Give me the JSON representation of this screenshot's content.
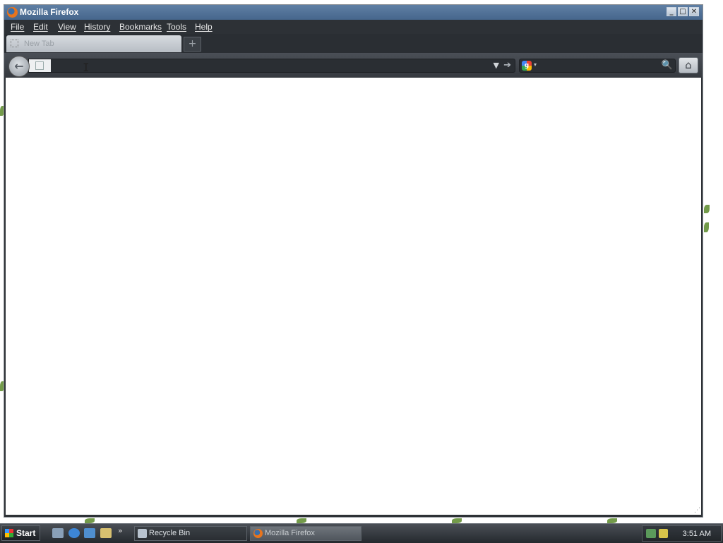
{
  "window": {
    "title": "Mozilla Firefox",
    "minimize_glyph": "_",
    "maximize_glyph": "□",
    "close_glyph": "✕"
  },
  "menubar": {
    "items": [
      "File",
      "Edit",
      "View",
      "History",
      "Bookmarks",
      "Tools",
      "Help"
    ]
  },
  "tabs": {
    "items": [
      {
        "label": "New Tab",
        "icon": "blank-page-icon"
      }
    ],
    "new_tab_glyph": "+"
  },
  "navbar": {
    "back_glyph": "←",
    "url_value": "",
    "dropdown_glyph": "▼",
    "go_glyph": "➔",
    "search_engine_letter": "g",
    "search_engine_arrow": "▾",
    "search_value": "",
    "search_glyph": "🔍",
    "home_glyph": "⌂"
  },
  "content": {
    "resize_glyph": "⋰"
  },
  "taskbar": {
    "start_label": "Start",
    "quick_launch_more": "»",
    "items": [
      {
        "label": "Recycle Bin",
        "icon": "recycle-bin-icon",
        "active": false
      },
      {
        "label": "Mozilla Firefox",
        "icon": "firefox-icon",
        "active": true
      }
    ],
    "clock": "3:51 AM"
  },
  "colors": {
    "titlebar": "#46668c",
    "chrome": "#2d3136",
    "taskbar": "#2b2f34"
  }
}
